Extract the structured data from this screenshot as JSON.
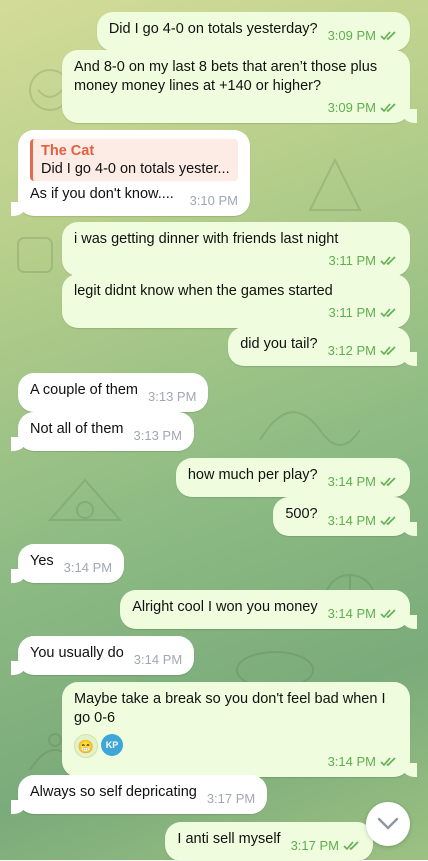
{
  "messages": [
    {
      "side": "out",
      "text": "Did I go 4-0 on totals yesterday?",
      "time": "3:09 PM"
    },
    {
      "side": "out",
      "text": "And 8-0 on my last 8 bets that aren’t those plus money money lines at +140 or higher?",
      "time": "3:09 PM"
    },
    {
      "side": "in",
      "reply_author": "The Cat",
      "reply_text": "Did I go 4-0 on totals yester...",
      "text": "As if you don't know....",
      "time": "3:10 PM"
    },
    {
      "side": "out",
      "text": "i was getting dinner with friends last night",
      "time": "3:11 PM"
    },
    {
      "side": "out",
      "text": "legit didnt know when the games started",
      "time": "3:11 PM"
    },
    {
      "side": "out",
      "text": "did you tail?",
      "time": "3:12 PM"
    },
    {
      "side": "in",
      "text": "A couple of them",
      "time": "3:13 PM"
    },
    {
      "side": "in",
      "text": "Not all of them",
      "time": "3:13 PM"
    },
    {
      "side": "out",
      "text": "how much per play?",
      "time": "3:14 PM"
    },
    {
      "side": "out",
      "text": "500?",
      "time": "3:14 PM"
    },
    {
      "side": "in",
      "text": "Yes",
      "time": "3:14 PM"
    },
    {
      "side": "out",
      "text": "Alright cool I won you money",
      "time": "3:14 PM"
    },
    {
      "side": "in",
      "text": "You usually do",
      "time": "3:14 PM"
    },
    {
      "side": "out",
      "text": "Maybe take a break so you don't feel bad when I go 0-6",
      "time": "3:14 PM",
      "reaction_emoji": "😁",
      "reaction_avatar": "KP"
    },
    {
      "side": "in",
      "text": "Always so self depricating",
      "time": "3:17 PM"
    },
    {
      "side": "out",
      "text": "I anti sell myself",
      "time": "3:17 PM"
    }
  ],
  "icons": {
    "read_receipt": "double-check-icon",
    "scroll_down": "chevron-down-icon"
  },
  "colors": {
    "outgoing_bubble": "#effdde",
    "incoming_bubble": "#ffffff",
    "outgoing_meta": "#5fae4f",
    "incoming_meta": "#a1a8b0",
    "reply_author": "#e0603f"
  }
}
